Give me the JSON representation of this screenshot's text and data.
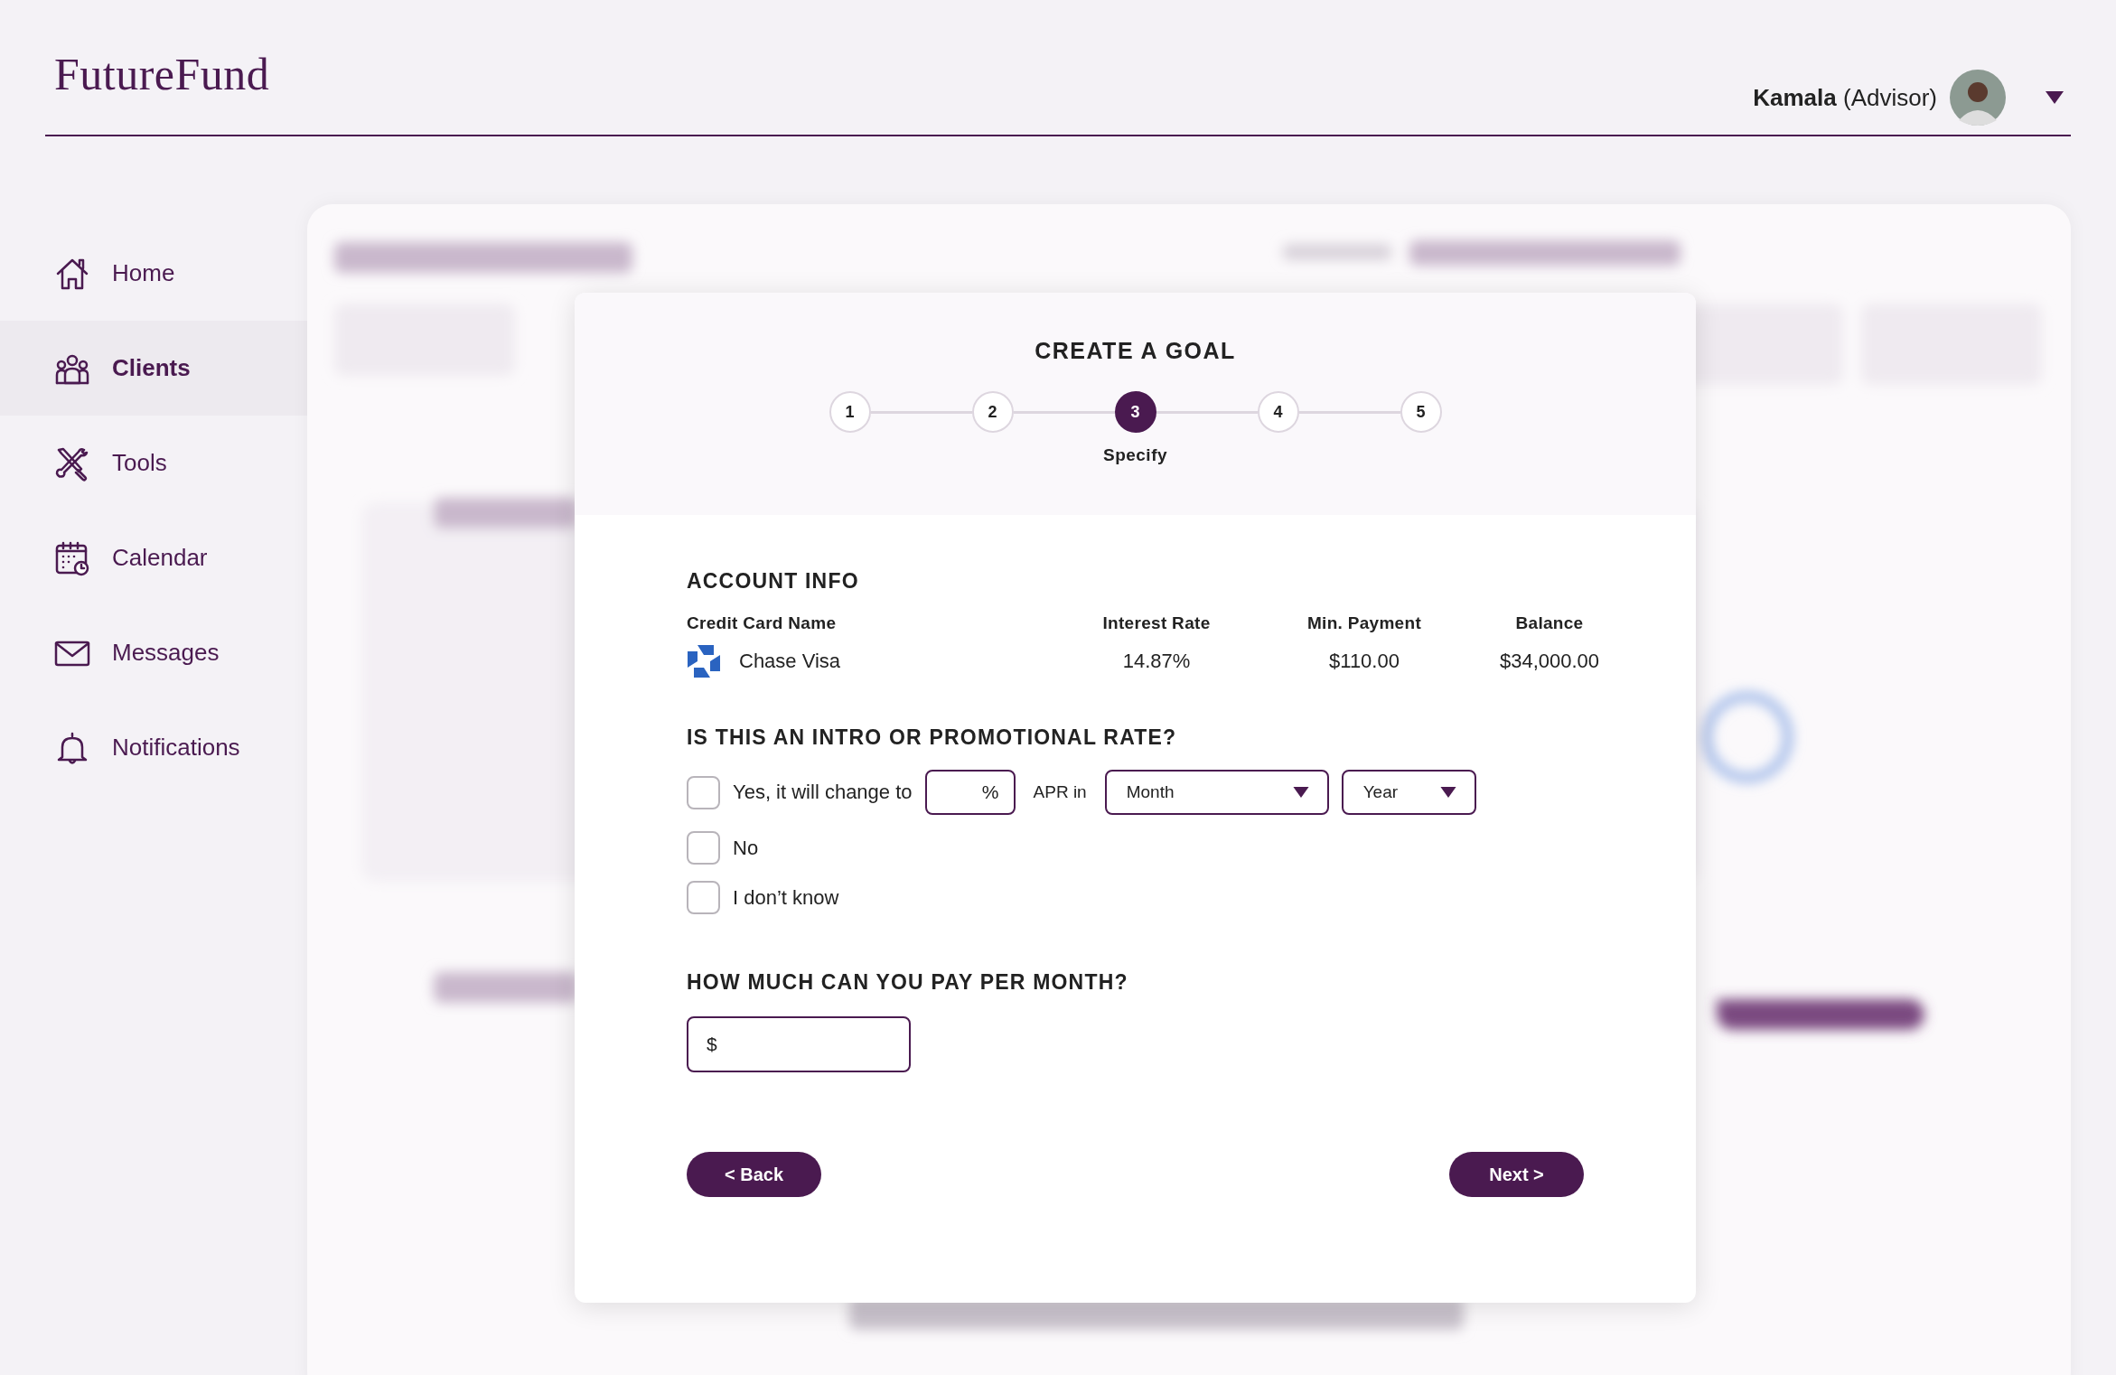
{
  "header": {
    "logo": "FutureFund",
    "user_name": "Kamala",
    "user_role": "(Advisor)"
  },
  "sidebar": {
    "items": [
      {
        "label": "Home",
        "kind": "home",
        "selected": false
      },
      {
        "label": "Clients",
        "kind": "people",
        "selected": true
      },
      {
        "label": "Tools",
        "kind": "tools",
        "selected": false
      },
      {
        "label": "Calendar",
        "kind": "calendar",
        "selected": false
      },
      {
        "label": "Messages",
        "kind": "mail",
        "selected": false
      },
      {
        "label": "Notifications",
        "kind": "bell",
        "selected": false
      }
    ]
  },
  "modal": {
    "title": "CREATE A GOAL",
    "steps": [
      {
        "number": "1",
        "selected": false
      },
      {
        "number": "2",
        "selected": false
      },
      {
        "number": "3",
        "selected": true,
        "label": "Specify"
      },
      {
        "number": "4",
        "selected": false
      },
      {
        "number": "5",
        "selected": false
      }
    ],
    "account": {
      "heading": "ACCOUNT INFO",
      "columns": [
        "Credit Card Name",
        "Interest Rate",
        "Min. Payment",
        "Balance"
      ],
      "card_name": "Chase Visa",
      "interest_rate": "14.87%",
      "min_payment": "$110.00",
      "balance": "$34,000.00"
    },
    "promo": {
      "question": "IS THIS AN INTRO OR PROMOTIONAL RATE?",
      "options": [
        {
          "kind": "rate",
          "label": "Yes, it will change to",
          "checked": false
        },
        {
          "kind": "plain",
          "label": "No",
          "checked": false
        },
        {
          "kind": "plain",
          "label": "I don’t know",
          "checked": false
        }
      ],
      "rate_suffix": "%",
      "apr_label": "APR in",
      "month_select": "Month",
      "year_select": "Year"
    },
    "payment": {
      "question": "HOW MUCH CAN YOU PAY PER MONTH?",
      "prefix": "$"
    },
    "buttons": {
      "back": "< Back",
      "next": "Next >"
    }
  }
}
